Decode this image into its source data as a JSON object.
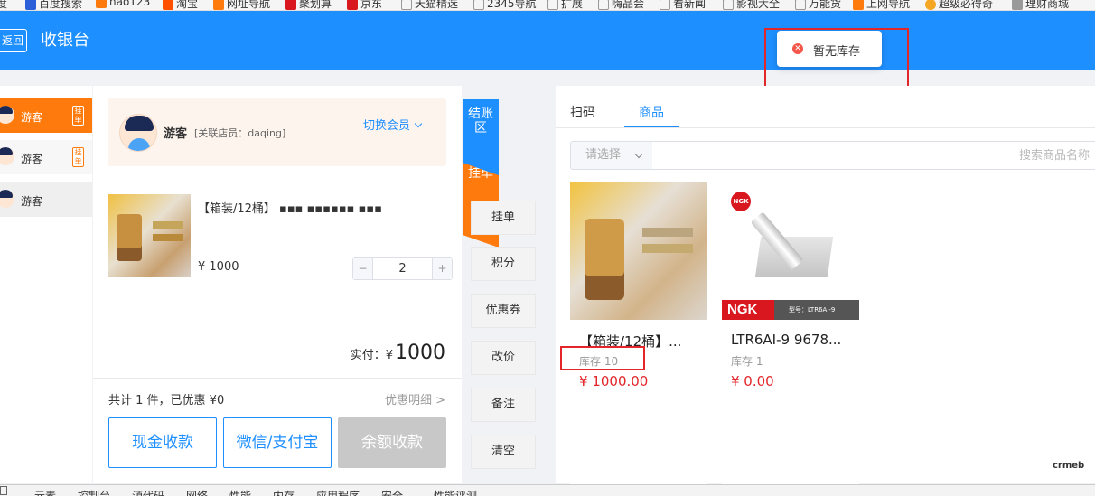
{
  "bookmarks": [
    "度",
    "百度搜索",
    "hao123",
    "淘宝",
    "网址导航",
    "聚划算",
    "京东",
    "天猫精选",
    "2345导航",
    "扩展",
    "嗨品会",
    "看新闻",
    "影视大全",
    "万能货",
    "上网导航",
    "超级必得奇",
    "理财商城"
  ],
  "header": {
    "back_label": "返回",
    "title": "收银台"
  },
  "toast": {
    "message": "暂无库存"
  },
  "members": [
    {
      "name": "游客",
      "tag": "挂单",
      "active": true
    },
    {
      "name": "游客",
      "tag": "挂单",
      "active": false
    },
    {
      "name": "游客",
      "tag": "",
      "active": false
    }
  ],
  "member_card": {
    "name": "游客",
    "staff": "[关联店员：daqing]",
    "switch_label": "切换会员"
  },
  "cart_item": {
    "title": "【箱装/12桶】 ▪▪▪ ▪▪▪▪▪▪ ▪▪▪",
    "price": "¥ 1000",
    "quantity": "2"
  },
  "cart_summary": {
    "paid_label": "实付：¥",
    "paid_amount": "1000",
    "summary_text": "共计 1 件，已优惠 ¥0",
    "discount_detail": "优惠明细 >"
  },
  "pay_buttons": {
    "cash": "现金收款",
    "wechat": "微信/支付宝",
    "balance": "余额收款"
  },
  "side_tabs": {
    "checkout": "结账区",
    "hold": "挂单"
  },
  "actions": [
    "挂单",
    "积分",
    "优惠券",
    "改价",
    "备注",
    "清空"
  ],
  "product_tabs": [
    "扫码",
    "商品"
  ],
  "search": {
    "select_placeholder": "请选择",
    "placeholder": "搜索商品名称"
  },
  "products": [
    {
      "name": "【箱装/12桶】...",
      "stock": "库存 10",
      "price": "¥ 1000.00"
    },
    {
      "name": "LTR6AI-9 9678...",
      "stock": "库存 1",
      "price": "¥ 0.00",
      "brand": "NGK",
      "model_label": "型号：LTR6AI-9"
    }
  ],
  "watermark": "crmeb",
  "devtools_tabs": [
    "元素",
    "控制台",
    "源代码",
    "网络",
    "性能",
    "内存",
    "应用程序",
    "安全",
    "性能评测"
  ],
  "colors": {
    "primary": "#1e8fff",
    "accent_orange": "#ff7a0c",
    "price_red": "#e2262a",
    "annotation_red": "#e2262a"
  }
}
